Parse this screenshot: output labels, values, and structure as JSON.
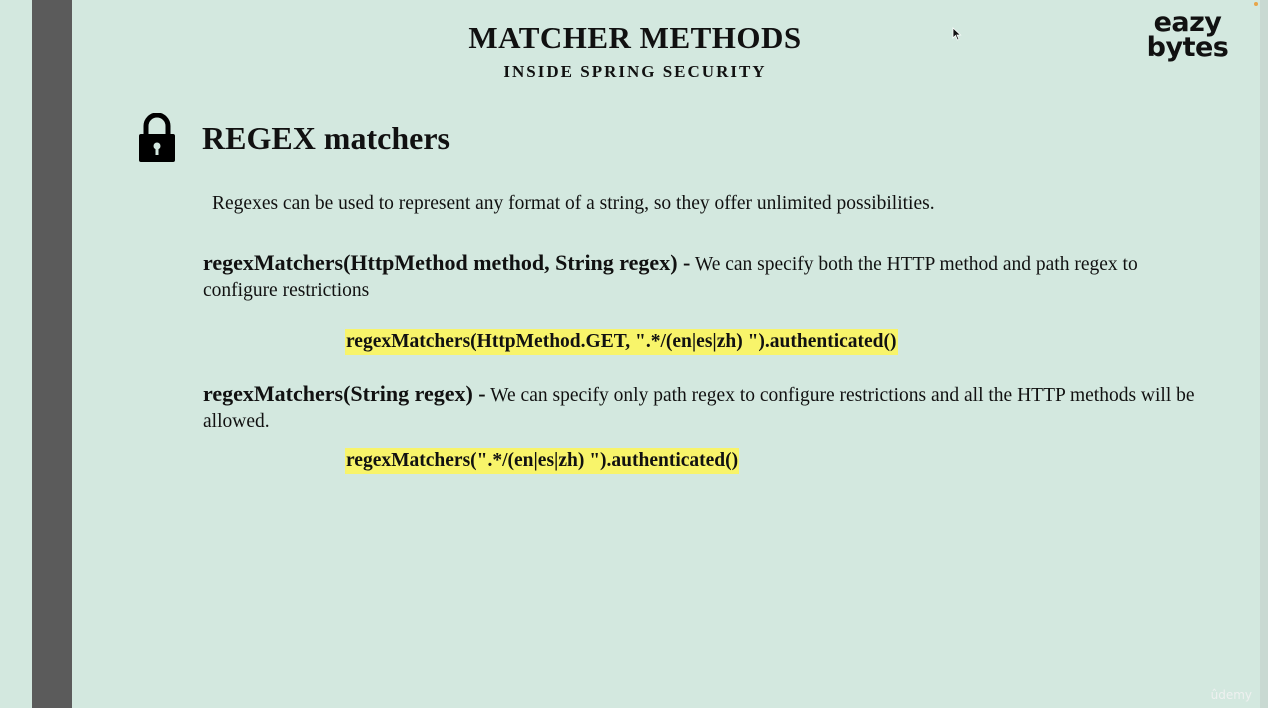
{
  "slide": {
    "title": "MATCHER METHODS",
    "subtitle": "INSIDE SPRING SECURITY"
  },
  "brand": {
    "line1": "eazy",
    "line2": "bytes"
  },
  "section": {
    "icon": "lock-icon",
    "heading": "REGEX matchers",
    "intro": "Regexes can be used to represent any format of  a string, so they offer unlimited possibilities."
  },
  "methods": [
    {
      "signature": "regexMatchers(HttpMethod method, String regex) -",
      "description": "We can specify both the HTTP method and path regex to configure restrictions",
      "example": "regexMatchers(HttpMethod.GET, \".*/(en|es|zh) \").authenticated()"
    },
    {
      "signature": "regexMatchers(String regex) -",
      "description": "We can specify only path regex to configure restrictions and all the HTTP methods will be allowed.",
      "example": "regexMatchers(\".*/(en|es|zh) \").authenticated()"
    }
  ],
  "watermark": "ûdemy",
  "colors": {
    "background": "#d3e8df",
    "highlight": "#f8f46a",
    "sidebar": "#5b5b5b"
  }
}
